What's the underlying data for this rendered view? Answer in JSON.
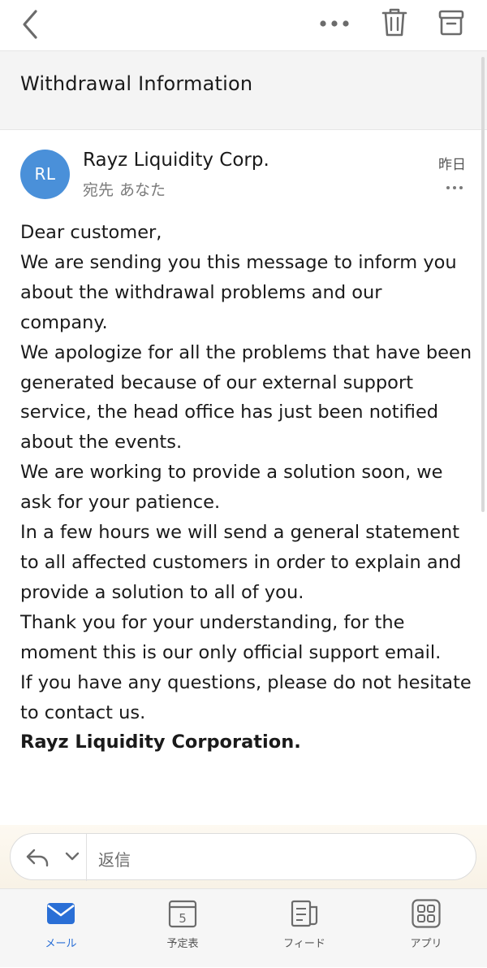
{
  "header": {
    "icons": [
      "back-icon",
      "more-icon",
      "trash-icon",
      "archive-icon"
    ]
  },
  "subject": "Withdrawal Information",
  "message": {
    "avatar_initials": "RL",
    "sender_name": "Rayz Liquidity Corp.",
    "recipient_label": "宛先",
    "recipient_value": "あなた",
    "date": "昨日",
    "body": [
      "Dear customer,",
      "We are sending you this message to inform you about the withdrawal problems and our company.",
      "We apologize for all the problems that have been generated because of our external support service, the head office has just been notified about the events.",
      "We are working to provide a solution soon, we ask for your patience.",
      "In a few hours we will send a general statement to all affected customers in order to explain and provide a solution to all of you.",
      "Thank you for your understanding, for the moment this is our only official support email.",
      "If you have any questions, please do not hesitate to contact us."
    ],
    "signature": "Rayz Liquidity Corporation."
  },
  "reply": {
    "label": "返信"
  },
  "tabs": [
    {
      "label": "メール",
      "icon": "mail-icon",
      "active": true
    },
    {
      "label": "予定表",
      "icon": "calendar-icon",
      "day": "5"
    },
    {
      "label": "フィード",
      "icon": "feed-icon"
    },
    {
      "label": "アプリ",
      "icon": "apps-icon"
    }
  ],
  "colors": {
    "accent": "#2a6fd6",
    "avatar": "#4a90d9",
    "icon_gray": "#6b6b6b"
  }
}
